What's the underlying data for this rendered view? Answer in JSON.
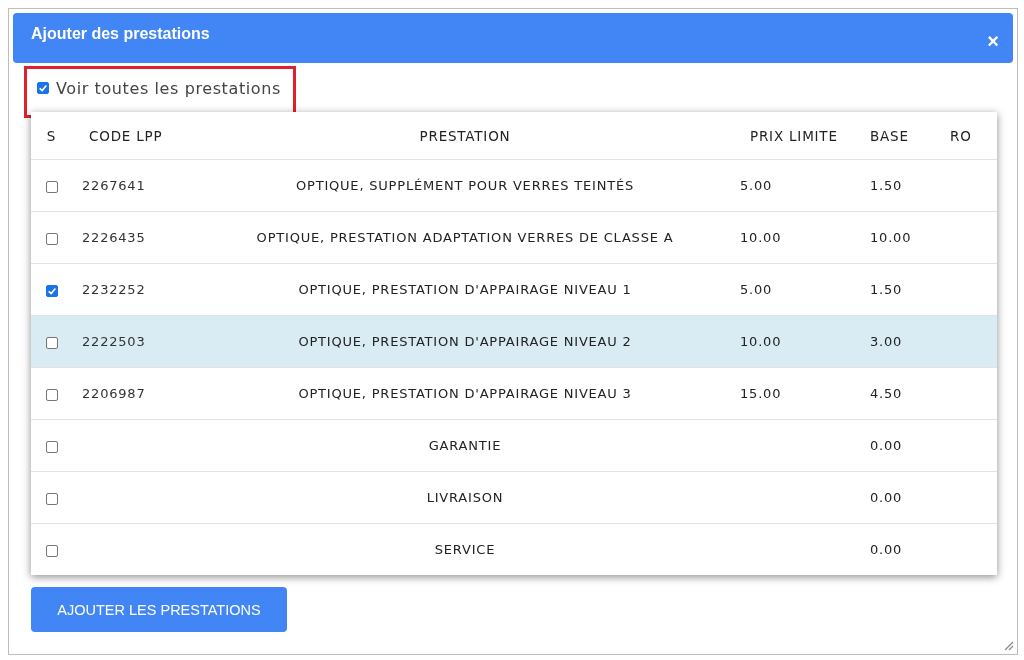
{
  "dialog": {
    "title": "Ajouter des prestations",
    "close": "×"
  },
  "show_all": {
    "label": "Voir toutes les prestations",
    "checked": true
  },
  "table": {
    "columns": [
      "S",
      "CODE LPP",
      "PRESTATION",
      "PRIX LIMITE",
      "BASE",
      "RO"
    ],
    "rows": [
      {
        "checked": false,
        "selected": false,
        "code": "2267641",
        "prestation": "OPTIQUE, SUPPLÉMENT POUR VERRES TEINTÉS",
        "prix": "5.00",
        "base": "1.50"
      },
      {
        "checked": false,
        "selected": false,
        "code": "2226435",
        "prestation": "OPTIQUE, PRESTATION ADAPTATION VERRES DE CLASSE A",
        "prix": "10.00",
        "base": "10.00"
      },
      {
        "checked": true,
        "selected": false,
        "code": "2232252",
        "prestation": "OPTIQUE, PRESTATION D'APPAIRAGE NIVEAU 1",
        "prix": "5.00",
        "base": "1.50"
      },
      {
        "checked": false,
        "selected": true,
        "code": "2222503",
        "prestation": "OPTIQUE, PRESTATION D'APPAIRAGE NIVEAU 2",
        "prix": "10.00",
        "base": "3.00"
      },
      {
        "checked": false,
        "selected": false,
        "code": "2206987",
        "prestation": "OPTIQUE, PRESTATION D'APPAIRAGE NIVEAU 3",
        "prix": "15.00",
        "base": "4.50"
      },
      {
        "checked": false,
        "selected": false,
        "prestation": "GARANTIE",
        "base": "0.00"
      },
      {
        "checked": false,
        "selected": false,
        "prestation": "LIVRAISON",
        "base": "0.00"
      },
      {
        "checked": false,
        "selected": false,
        "prestation": "SERVICE",
        "base": "0.00"
      }
    ]
  },
  "add_button": "AJOUTER LES PRESTATIONS"
}
